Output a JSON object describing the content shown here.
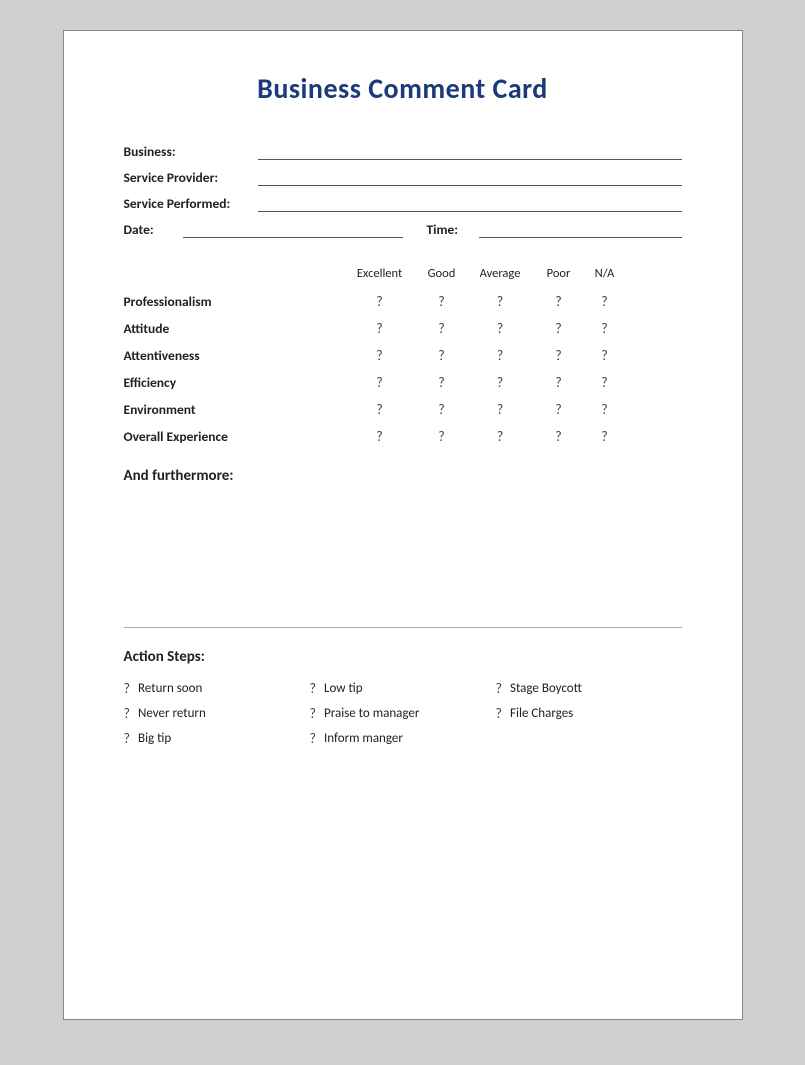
{
  "card": {
    "title": "Business Comment Card",
    "fields": {
      "business_label": "Business:",
      "service_provider_label": "Service Provider:",
      "service_performed_label": "Service Performed:",
      "date_label": "Date:",
      "time_label": "Time:"
    },
    "rating_headers": {
      "excellent": "Excellent",
      "good": "Good",
      "average": "Average",
      "poor": "Poor",
      "na": "N/A"
    },
    "rating_rows": [
      {
        "label": "Professionalism"
      },
      {
        "label": "Attitude"
      },
      {
        "label": "Attentiveness"
      },
      {
        "label": "Efficiency"
      },
      {
        "label": "Environment"
      },
      {
        "label": "Overall Experience"
      }
    ],
    "radio_symbol": "?",
    "and_furthermore_label": "And furthermore:",
    "divider": true,
    "action_steps": {
      "title": "Action Steps:",
      "items": [
        {
          "col": 0,
          "row": 0,
          "text": "Return soon"
        },
        {
          "col": 1,
          "row": 0,
          "text": "Low tip"
        },
        {
          "col": 2,
          "row": 0,
          "text": "Stage Boycott"
        },
        {
          "col": 0,
          "row": 1,
          "text": "Never return"
        },
        {
          "col": 1,
          "row": 1,
          "text": "Praise to manager"
        },
        {
          "col": 2,
          "row": 1,
          "text": "File Charges"
        },
        {
          "col": 0,
          "row": 2,
          "text": "Big tip"
        },
        {
          "col": 1,
          "row": 2,
          "text": "Inform manger"
        }
      ]
    }
  }
}
